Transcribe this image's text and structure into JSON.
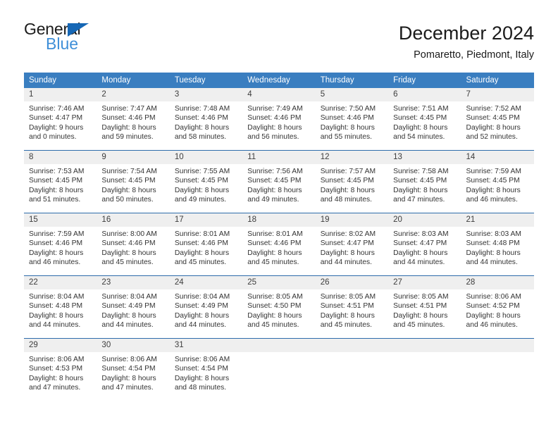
{
  "brand": {
    "name_dark": "General",
    "name_blue": "Blue",
    "triangle_color": "#1667b5",
    "blue_color": "#3f8fd8"
  },
  "header": {
    "title": "December 2024",
    "subtitle": "Pomaretto, Piedmont, Italy"
  },
  "theme": {
    "header_blue": "#3a7ec0",
    "row_divider": "#2e6cab",
    "daynum_band": "#efefef"
  },
  "weekday_headers": [
    "Sunday",
    "Monday",
    "Tuesday",
    "Wednesday",
    "Thursday",
    "Friday",
    "Saturday"
  ],
  "weeks": [
    [
      {
        "day": "1",
        "sunrise": "Sunrise: 7:46 AM",
        "sunset": "Sunset: 4:47 PM",
        "daylight1": "Daylight: 9 hours",
        "daylight2": "and 0 minutes."
      },
      {
        "day": "2",
        "sunrise": "Sunrise: 7:47 AM",
        "sunset": "Sunset: 4:46 PM",
        "daylight1": "Daylight: 8 hours",
        "daylight2": "and 59 minutes."
      },
      {
        "day": "3",
        "sunrise": "Sunrise: 7:48 AM",
        "sunset": "Sunset: 4:46 PM",
        "daylight1": "Daylight: 8 hours",
        "daylight2": "and 58 minutes."
      },
      {
        "day": "4",
        "sunrise": "Sunrise: 7:49 AM",
        "sunset": "Sunset: 4:46 PM",
        "daylight1": "Daylight: 8 hours",
        "daylight2": "and 56 minutes."
      },
      {
        "day": "5",
        "sunrise": "Sunrise: 7:50 AM",
        "sunset": "Sunset: 4:46 PM",
        "daylight1": "Daylight: 8 hours",
        "daylight2": "and 55 minutes."
      },
      {
        "day": "6",
        "sunrise": "Sunrise: 7:51 AM",
        "sunset": "Sunset: 4:45 PM",
        "daylight1": "Daylight: 8 hours",
        "daylight2": "and 54 minutes."
      },
      {
        "day": "7",
        "sunrise": "Sunrise: 7:52 AM",
        "sunset": "Sunset: 4:45 PM",
        "daylight1": "Daylight: 8 hours",
        "daylight2": "and 52 minutes."
      }
    ],
    [
      {
        "day": "8",
        "sunrise": "Sunrise: 7:53 AM",
        "sunset": "Sunset: 4:45 PM",
        "daylight1": "Daylight: 8 hours",
        "daylight2": "and 51 minutes."
      },
      {
        "day": "9",
        "sunrise": "Sunrise: 7:54 AM",
        "sunset": "Sunset: 4:45 PM",
        "daylight1": "Daylight: 8 hours",
        "daylight2": "and 50 minutes."
      },
      {
        "day": "10",
        "sunrise": "Sunrise: 7:55 AM",
        "sunset": "Sunset: 4:45 PM",
        "daylight1": "Daylight: 8 hours",
        "daylight2": "and 49 minutes."
      },
      {
        "day": "11",
        "sunrise": "Sunrise: 7:56 AM",
        "sunset": "Sunset: 4:45 PM",
        "daylight1": "Daylight: 8 hours",
        "daylight2": "and 49 minutes."
      },
      {
        "day": "12",
        "sunrise": "Sunrise: 7:57 AM",
        "sunset": "Sunset: 4:45 PM",
        "daylight1": "Daylight: 8 hours",
        "daylight2": "and 48 minutes."
      },
      {
        "day": "13",
        "sunrise": "Sunrise: 7:58 AM",
        "sunset": "Sunset: 4:45 PM",
        "daylight1": "Daylight: 8 hours",
        "daylight2": "and 47 minutes."
      },
      {
        "day": "14",
        "sunrise": "Sunrise: 7:59 AM",
        "sunset": "Sunset: 4:45 PM",
        "daylight1": "Daylight: 8 hours",
        "daylight2": "and 46 minutes."
      }
    ],
    [
      {
        "day": "15",
        "sunrise": "Sunrise: 7:59 AM",
        "sunset": "Sunset: 4:46 PM",
        "daylight1": "Daylight: 8 hours",
        "daylight2": "and 46 minutes."
      },
      {
        "day": "16",
        "sunrise": "Sunrise: 8:00 AM",
        "sunset": "Sunset: 4:46 PM",
        "daylight1": "Daylight: 8 hours",
        "daylight2": "and 45 minutes."
      },
      {
        "day": "17",
        "sunrise": "Sunrise: 8:01 AM",
        "sunset": "Sunset: 4:46 PM",
        "daylight1": "Daylight: 8 hours",
        "daylight2": "and 45 minutes."
      },
      {
        "day": "18",
        "sunrise": "Sunrise: 8:01 AM",
        "sunset": "Sunset: 4:46 PM",
        "daylight1": "Daylight: 8 hours",
        "daylight2": "and 45 minutes."
      },
      {
        "day": "19",
        "sunrise": "Sunrise: 8:02 AM",
        "sunset": "Sunset: 4:47 PM",
        "daylight1": "Daylight: 8 hours",
        "daylight2": "and 44 minutes."
      },
      {
        "day": "20",
        "sunrise": "Sunrise: 8:03 AM",
        "sunset": "Sunset: 4:47 PM",
        "daylight1": "Daylight: 8 hours",
        "daylight2": "and 44 minutes."
      },
      {
        "day": "21",
        "sunrise": "Sunrise: 8:03 AM",
        "sunset": "Sunset: 4:48 PM",
        "daylight1": "Daylight: 8 hours",
        "daylight2": "and 44 minutes."
      }
    ],
    [
      {
        "day": "22",
        "sunrise": "Sunrise: 8:04 AM",
        "sunset": "Sunset: 4:48 PM",
        "daylight1": "Daylight: 8 hours",
        "daylight2": "and 44 minutes."
      },
      {
        "day": "23",
        "sunrise": "Sunrise: 8:04 AM",
        "sunset": "Sunset: 4:49 PM",
        "daylight1": "Daylight: 8 hours",
        "daylight2": "and 44 minutes."
      },
      {
        "day": "24",
        "sunrise": "Sunrise: 8:04 AM",
        "sunset": "Sunset: 4:49 PM",
        "daylight1": "Daylight: 8 hours",
        "daylight2": "and 44 minutes."
      },
      {
        "day": "25",
        "sunrise": "Sunrise: 8:05 AM",
        "sunset": "Sunset: 4:50 PM",
        "daylight1": "Daylight: 8 hours",
        "daylight2": "and 45 minutes."
      },
      {
        "day": "26",
        "sunrise": "Sunrise: 8:05 AM",
        "sunset": "Sunset: 4:51 PM",
        "daylight1": "Daylight: 8 hours",
        "daylight2": "and 45 minutes."
      },
      {
        "day": "27",
        "sunrise": "Sunrise: 8:05 AM",
        "sunset": "Sunset: 4:51 PM",
        "daylight1": "Daylight: 8 hours",
        "daylight2": "and 45 minutes."
      },
      {
        "day": "28",
        "sunrise": "Sunrise: 8:06 AM",
        "sunset": "Sunset: 4:52 PM",
        "daylight1": "Daylight: 8 hours",
        "daylight2": "and 46 minutes."
      }
    ],
    [
      {
        "day": "29",
        "sunrise": "Sunrise: 8:06 AM",
        "sunset": "Sunset: 4:53 PM",
        "daylight1": "Daylight: 8 hours",
        "daylight2": "and 47 minutes."
      },
      {
        "day": "30",
        "sunrise": "Sunrise: 8:06 AM",
        "sunset": "Sunset: 4:54 PM",
        "daylight1": "Daylight: 8 hours",
        "daylight2": "and 47 minutes."
      },
      {
        "day": "31",
        "sunrise": "Sunrise: 8:06 AM",
        "sunset": "Sunset: 4:54 PM",
        "daylight1": "Daylight: 8 hours",
        "daylight2": "and 48 minutes."
      },
      {
        "day": "",
        "sunrise": "",
        "sunset": "",
        "daylight1": "",
        "daylight2": ""
      },
      {
        "day": "",
        "sunrise": "",
        "sunset": "",
        "daylight1": "",
        "daylight2": ""
      },
      {
        "day": "",
        "sunrise": "",
        "sunset": "",
        "daylight1": "",
        "daylight2": ""
      },
      {
        "day": "",
        "sunrise": "",
        "sunset": "",
        "daylight1": "",
        "daylight2": ""
      }
    ]
  ]
}
